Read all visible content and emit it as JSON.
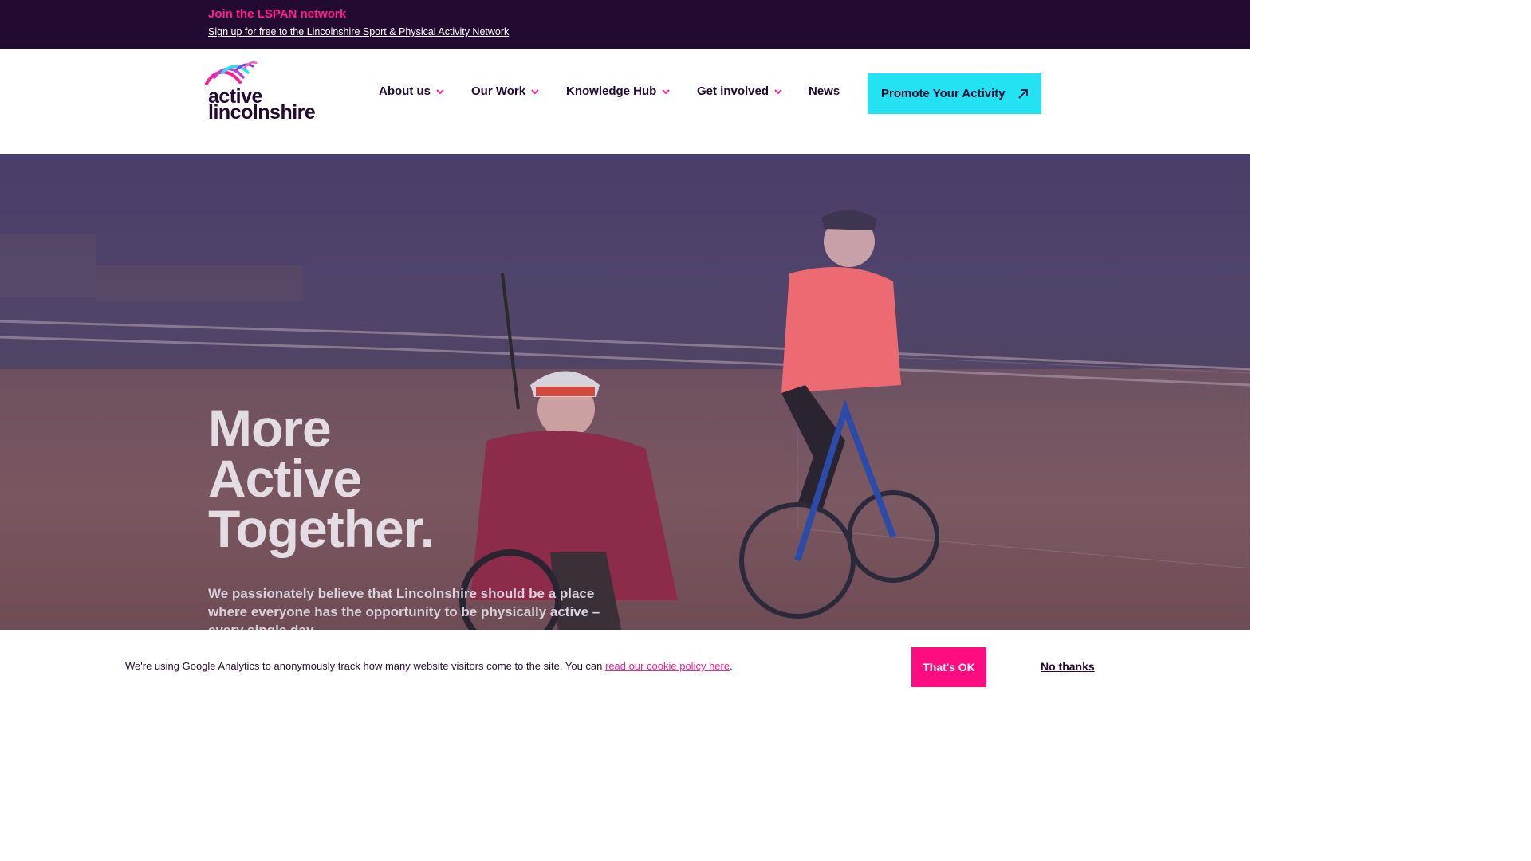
{
  "topbar": {
    "title": "Join the LSPAN network",
    "link": "Sign up for free to the Lincolnshire Sport & Physical Activity Network"
  },
  "logo": {
    "line1": "active",
    "line2": "lincolnshire",
    "icon": "swoosh-logo-icon"
  },
  "nav": {
    "items": [
      {
        "label": "About us",
        "has_dropdown": true
      },
      {
        "label": "Our Work",
        "has_dropdown": true
      },
      {
        "label": "Knowledge Hub",
        "has_dropdown": true
      },
      {
        "label": "Get involved",
        "has_dropdown": true
      },
      {
        "label": "News",
        "has_dropdown": false
      }
    ],
    "cta": {
      "label": "Promote Your Activity",
      "icon": "arrow-up-right-icon"
    }
  },
  "hero": {
    "title_lines": [
      "More",
      "Active",
      "Together."
    ],
    "text": "We passionately believe that Lincolnshire should be a place where everyone has the opportunity to be physically active – every single day."
  },
  "cookie": {
    "message_prefix": "We're using Google Analytics to anonymously track how many website visitors come to the site. You can ",
    "policy_link": "read our cookie policy here",
    "message_suffix": ".",
    "accept_label": "That's OK",
    "decline_label": "No thanks"
  },
  "colors": {
    "dark_purple": "#230a31",
    "pink": "#ff1f8e",
    "cyan": "#23e3f3",
    "cookie_button": "#ff0d80"
  }
}
